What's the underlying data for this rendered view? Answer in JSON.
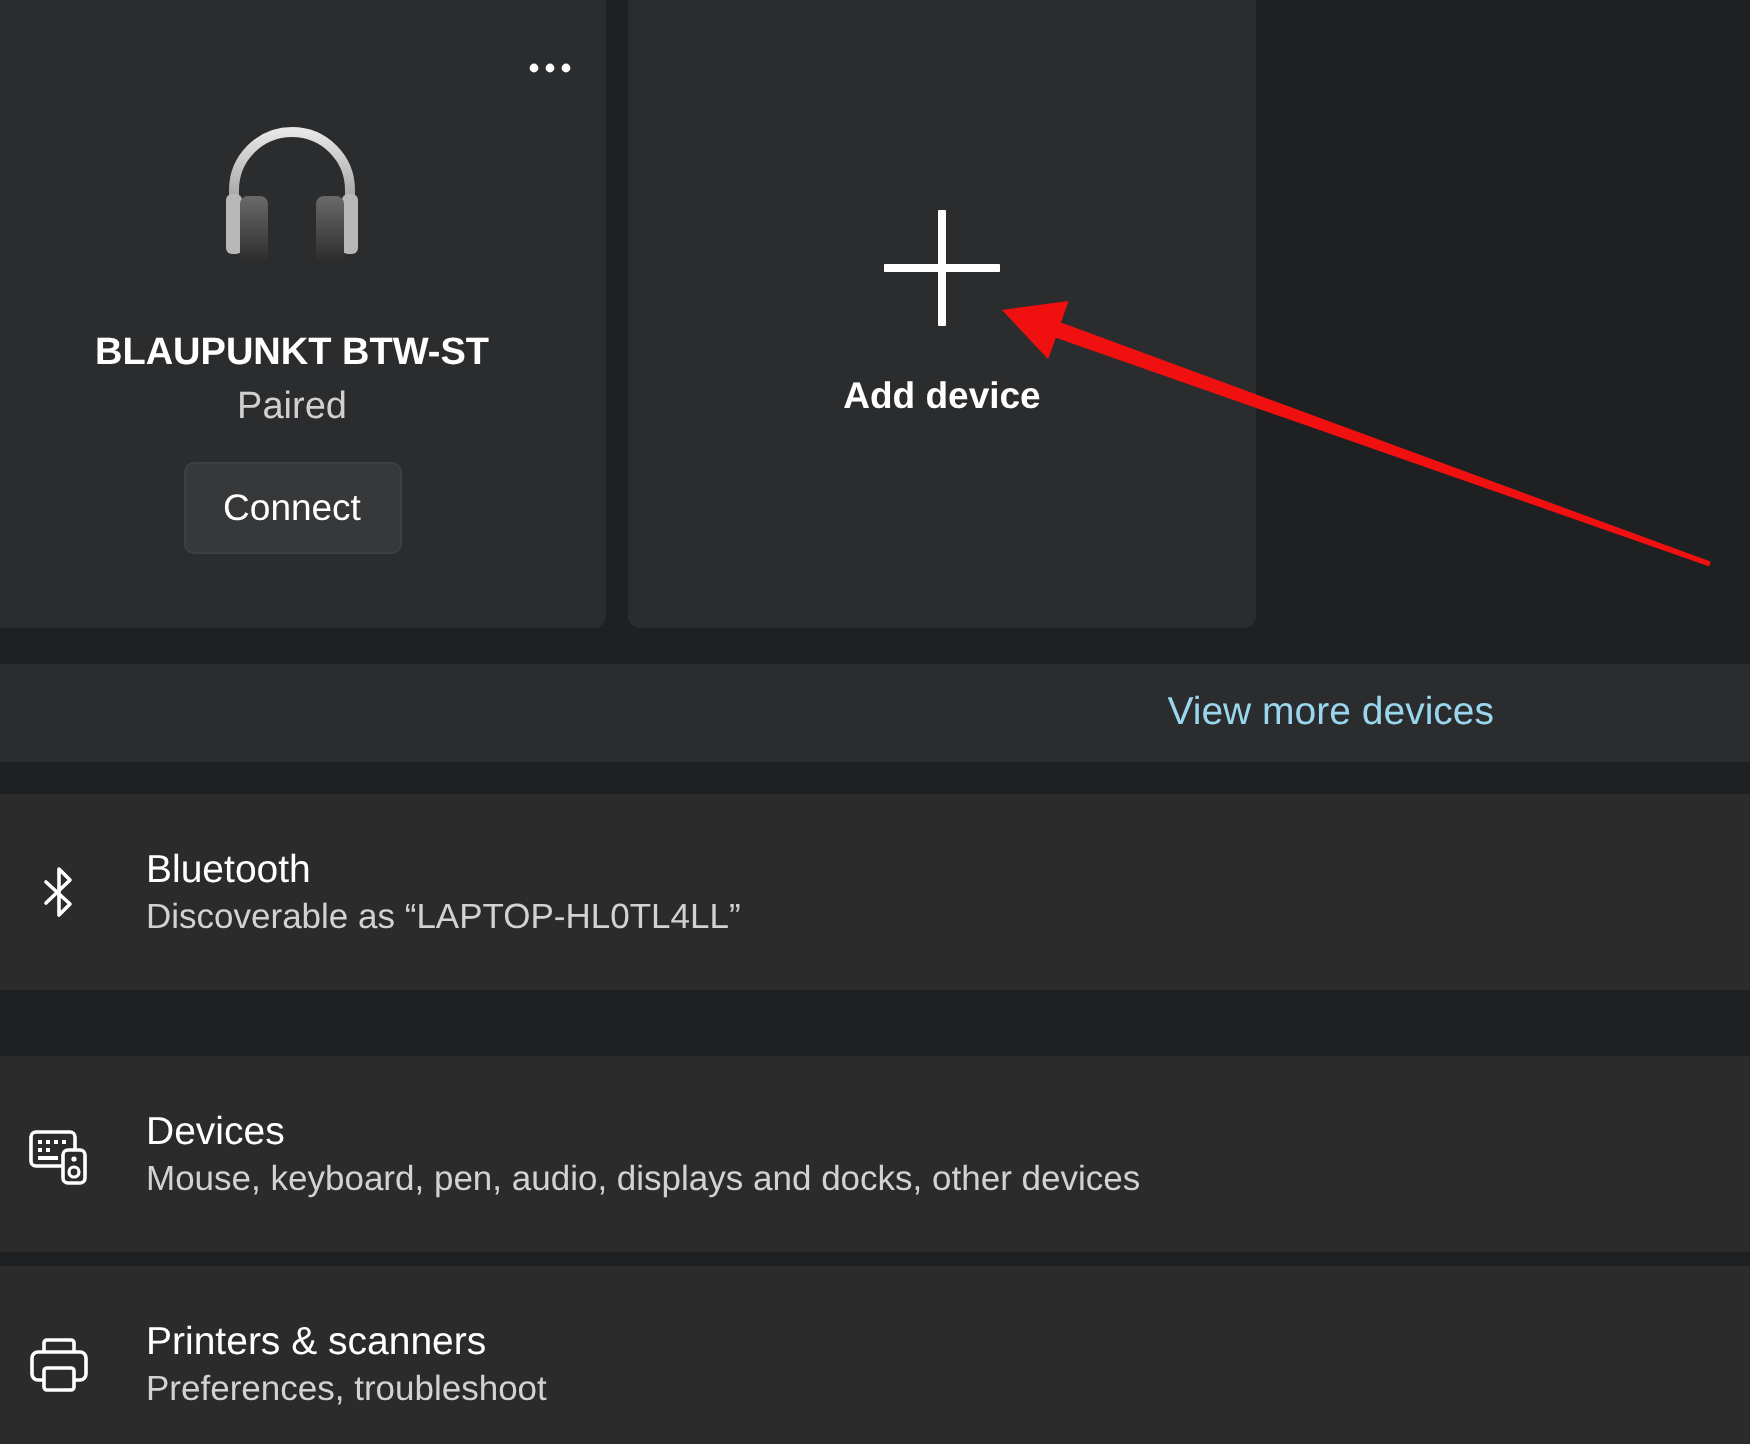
{
  "device_cards": [
    {
      "kind": "device",
      "name": "BLAUPUNKT BTW-ST",
      "status": "Paired",
      "button": "Connect"
    },
    {
      "kind": "add",
      "label": "Add device"
    }
  ],
  "view_more": {
    "label": "View more devices"
  },
  "sections": [
    {
      "items": [
        {
          "kind": "bluetooth",
          "title": "Bluetooth",
          "subtitle": "Discoverable as “LAPTOP-HL0TL4LL”"
        }
      ]
    },
    {
      "items": [
        {
          "kind": "devices",
          "title": "Devices",
          "subtitle": "Mouse, keyboard, pen, audio, displays and docks, other devices"
        },
        {
          "kind": "printers",
          "title": "Printers & scanners",
          "subtitle": "Preferences, troubleshoot"
        }
      ]
    }
  ],
  "annotations": [
    {
      "kind": "arrow"
    }
  ]
}
